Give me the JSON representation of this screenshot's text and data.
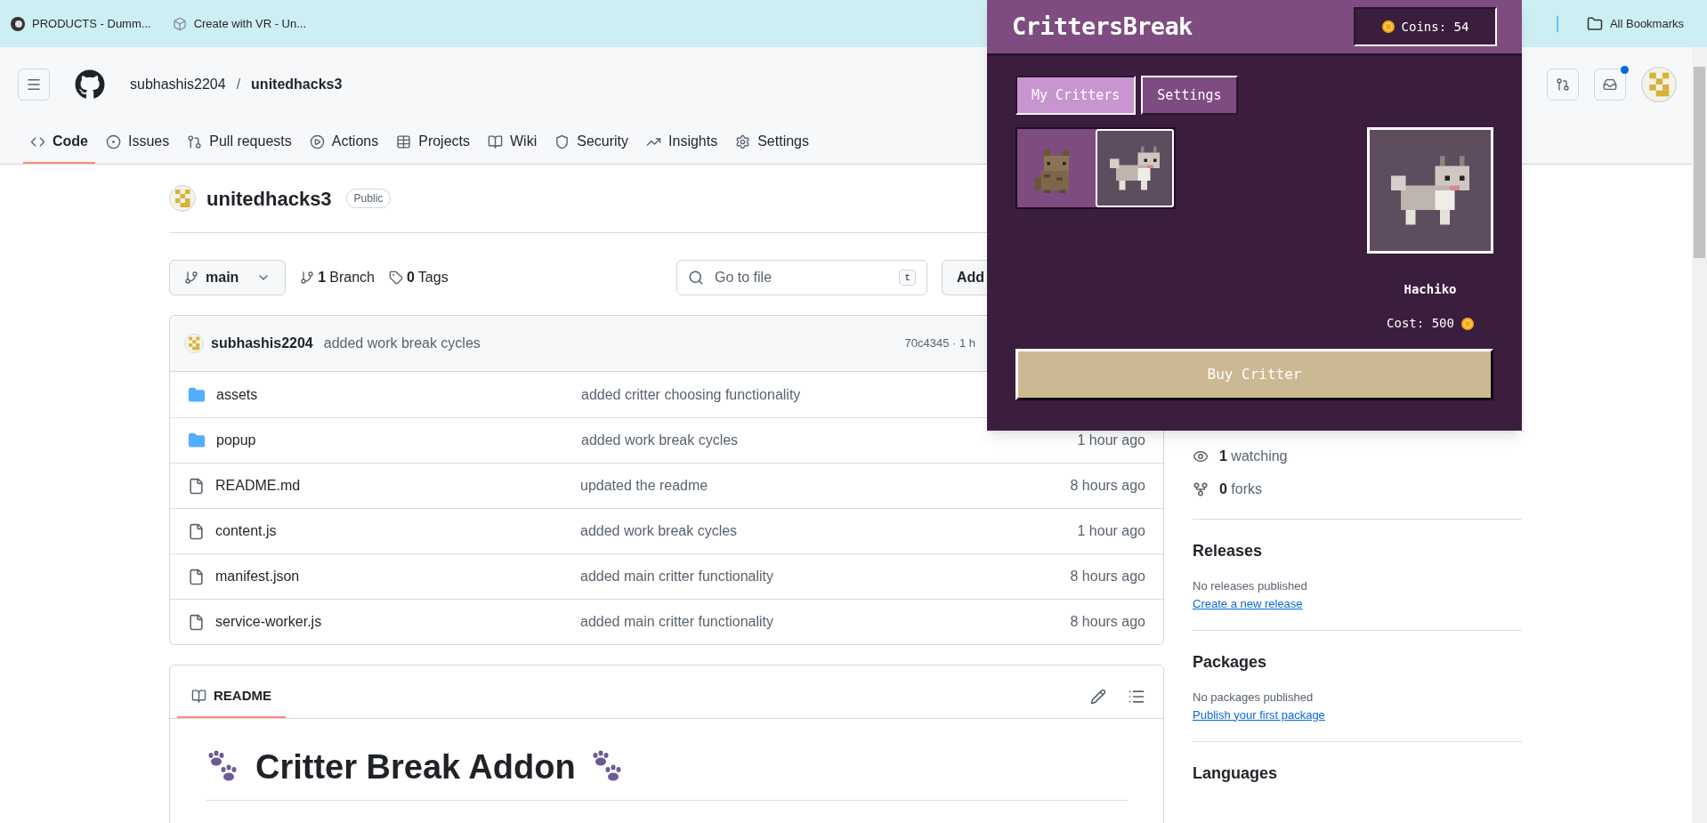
{
  "bookmarks_bar": {
    "items": [
      {
        "kind": "circle",
        "label": "PRODUCTS - Dumm..."
      },
      {
        "kind": "cube",
        "label": "Create with VR - Un..."
      }
    ],
    "all_bookmarks": "All Bookmarks"
  },
  "header": {
    "owner": "subhashis2204",
    "separator": "/",
    "repo": "unitedhacks3",
    "inbox_unread": true
  },
  "repo_tabs": [
    {
      "kind": "code",
      "label": "Code",
      "selected": true
    },
    {
      "kind": "issues",
      "label": "Issues",
      "selected": false
    },
    {
      "kind": "pulls",
      "label": "Pull requests",
      "selected": false
    },
    {
      "kind": "actions",
      "label": "Actions",
      "selected": false
    },
    {
      "kind": "projects",
      "label": "Projects",
      "selected": false
    },
    {
      "kind": "wiki",
      "label": "Wiki",
      "selected": false
    },
    {
      "kind": "security",
      "label": "Security",
      "selected": false
    },
    {
      "kind": "insights",
      "label": "Insights",
      "selected": false
    },
    {
      "kind": "settings",
      "label": "Settings",
      "selected": false
    }
  ],
  "repo": {
    "name": "unitedhacks3",
    "visibility": "Public"
  },
  "toolbar": {
    "branch": "main",
    "branches_count": "1",
    "branches_label": "Branch",
    "tags_count": "0",
    "tags_label": "Tags",
    "search_placeholder": "Go to file",
    "search_shortcut": "t",
    "add_button": "Add"
  },
  "latest_commit": {
    "author": "subhashis2204",
    "message": "added work break cycles",
    "hash_time": "70c4345 · 1 h"
  },
  "files": [
    {
      "kind": "folder",
      "name": "assets",
      "message": "added critter choosing functionality"
    },
    {
      "kind": "folder",
      "name": "popup",
      "message": "added work break cycles",
      "time": "1 hour ago"
    },
    {
      "kind": "file",
      "name": "README.md",
      "message": "updated the readme",
      "time": "8 hours ago"
    },
    {
      "kind": "file",
      "name": "content.js",
      "message": "added work break cycles",
      "time": "1 hour ago"
    },
    {
      "kind": "file",
      "name": "manifest.json",
      "message": "added main critter functionality",
      "time": "8 hours ago"
    },
    {
      "kind": "file",
      "name": "service-worker.js",
      "message": "added main critter functionality",
      "time": "8 hours ago"
    }
  ],
  "readme": {
    "tab": "README",
    "heading": "Critter Break Addon"
  },
  "sidebar": {
    "watching_count": "1",
    "watching_label": "watching",
    "forks_count": "0",
    "forks_label": "forks",
    "sections": [
      {
        "title": "Releases",
        "note": "No releases published",
        "link": "Create a new release"
      },
      {
        "title": "Packages",
        "note": "No packages published",
        "link": "Publish your first package"
      },
      {
        "title": "Languages"
      }
    ]
  },
  "popup": {
    "title": "CrittersBreak",
    "coins": "Coins: 54",
    "tabs": [
      {
        "label": "My Critters",
        "selected": true
      },
      {
        "label": "Settings",
        "selected": false
      }
    ],
    "critters": [
      {
        "kind": "cat",
        "selected": false
      },
      {
        "kind": "dog",
        "selected": true
      }
    ],
    "preview": {
      "kind": "dog",
      "name": "Hachiko",
      "cost": "Cost: 500"
    },
    "buy_button": "Buy Critter"
  }
}
